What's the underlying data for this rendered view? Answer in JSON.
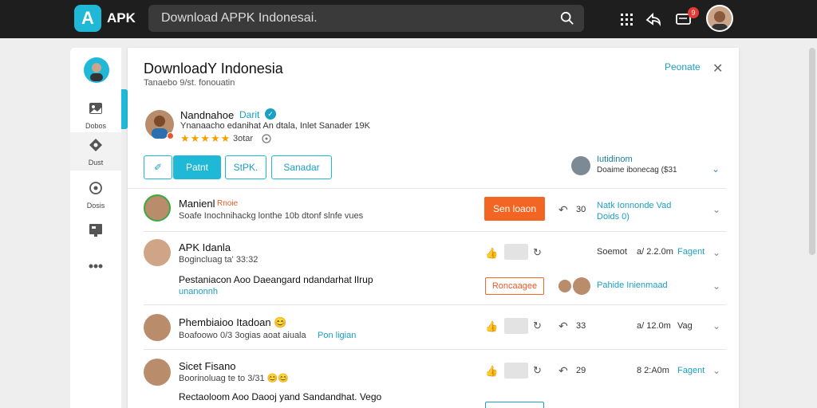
{
  "topbar": {
    "logo_letter": "A",
    "logo_text": "APK",
    "search_text": "Download APPK Indonesai.",
    "notification_count": "9"
  },
  "sidebar": {
    "items": [
      {
        "label": "Dobos",
        "icon": "image-icon"
      },
      {
        "label": "Dust",
        "icon": "diamond-icon"
      },
      {
        "label": "Dosis",
        "icon": "circle-icon"
      },
      {
        "label": "",
        "icon": "card-icon"
      },
      {
        "label": "",
        "icon": "more-icon"
      }
    ]
  },
  "panel": {
    "title": "DownloadY Indonesia",
    "subtitle": "Tanaebo 9/st. fonouatin",
    "action": "Peonate",
    "profile": {
      "name": "Nandnahoe",
      "tag": "Darit",
      "description": "Ynanaacho edanihat An dtala, Inlet Sanader 19K",
      "stars": "★★★★★",
      "rating": "3otar"
    },
    "buttons": {
      "icon_button": "✐",
      "primary": "Patnt",
      "secondary": "StPK.",
      "tertiary": "Sanadar"
    },
    "right_user": {
      "name": "Iutidinom",
      "sub": "Doaime ibonecag ($31"
    },
    "rows": [
      {
        "name": "Manienl",
        "tag": "Rnoie",
        "sub": "Soafe Inochnihackg lonthe 10b dtonf slnfe vues",
        "cta": "Sen loaon",
        "count": "30",
        "right_line1": "Natk Ionnonde Vad",
        "right_line2": "Doids 0)"
      },
      {
        "name": "APK Idanla",
        "sub": "Bogincluag ta' 33:32",
        "line": "Pestaniacon Aoo Daeangard ndandarhat lIrup",
        "line_tag": "unanonnh",
        "outline_label": "Roncaagee",
        "meta": "Soemot",
        "time": "a/ 2.2.0m",
        "time_tag": "Fagent",
        "right_link": "Pahide Inienmaad"
      },
      {
        "name": "Phembiaioo Itadoan 😊",
        "sub": "Boafoowo 0/3 3ogias aoat aiuala",
        "sub_tag": "Pon ligian",
        "count": "33",
        "time": "a/ 12.0m",
        "time_tag": "Vag"
      },
      {
        "name": "Sicet Fisano",
        "sub": "Boorinoluag te to 3/31 😊😊",
        "line": "Rectaoloom Aoo Daooj yand Sandandhat. Vego",
        "count": "29",
        "time": "8 2:A0m",
        "time_tag": "Fagent"
      }
    ]
  },
  "colors": {
    "accent": "#1fb8d6",
    "orange": "#f26522",
    "topbar": "#1e1e1e",
    "star": "#f4a100"
  }
}
